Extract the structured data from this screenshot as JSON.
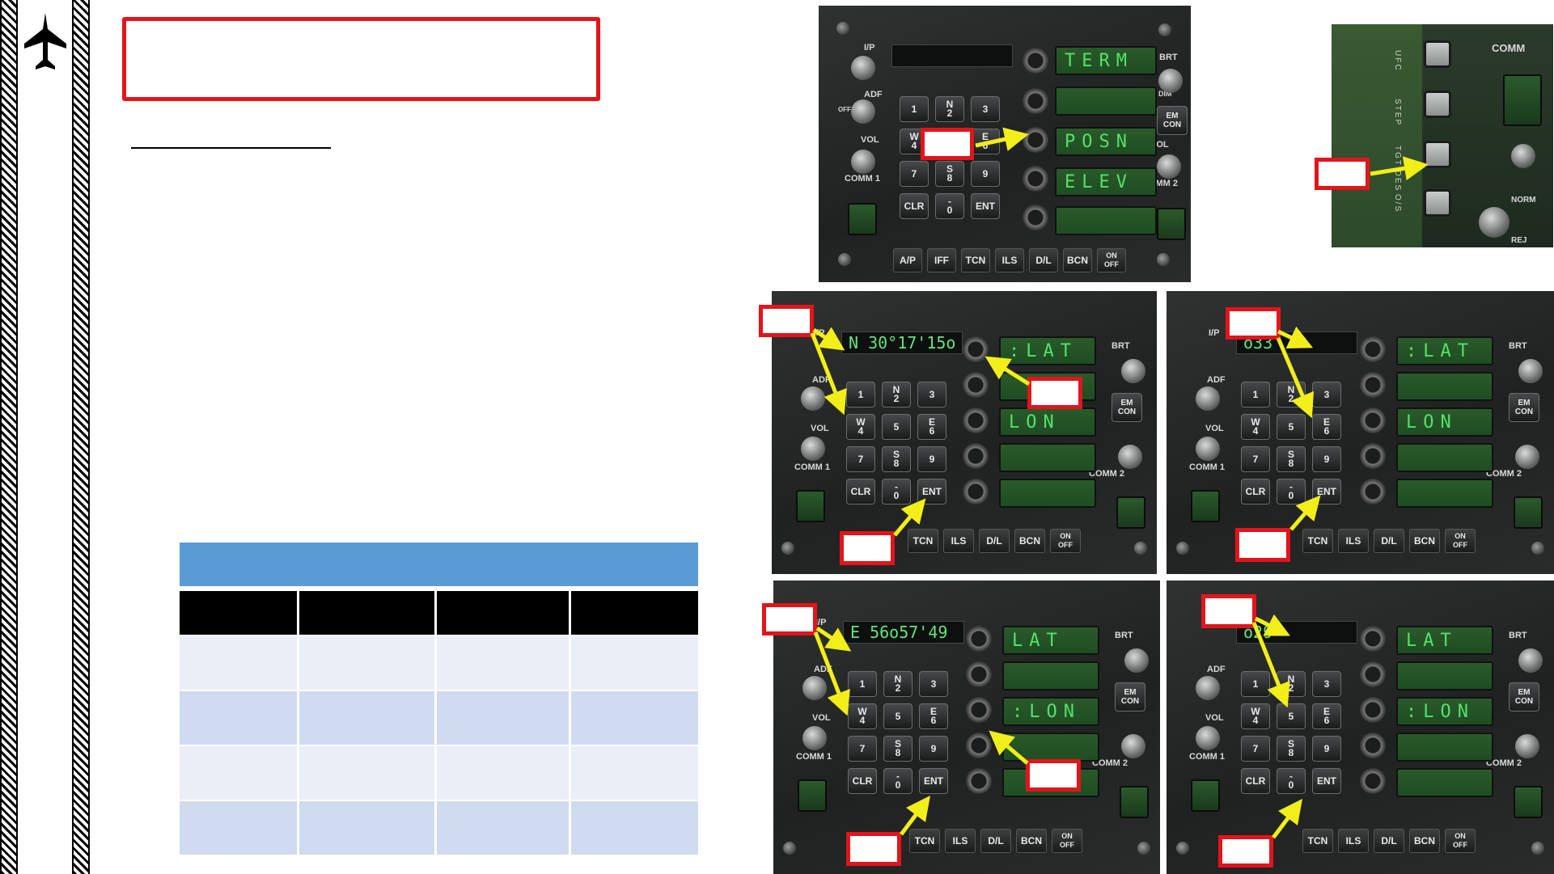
{
  "sidebar": {
    "icon": "jet-icon"
  },
  "slide": {
    "title_text": "",
    "subtitle_text": ""
  },
  "table": {
    "title": "",
    "headers": [
      "",
      "",
      "",
      ""
    ],
    "rows": [
      [
        "",
        "",
        "",
        ""
      ],
      [
        "",
        "",
        "",
        ""
      ],
      [
        "",
        "",
        "",
        ""
      ],
      [
        "",
        "",
        "",
        ""
      ]
    ]
  },
  "ufc_top": {
    "labels": {
      "ip": "I/P",
      "brt": "BRT",
      "adf": "ADF",
      "off": "OFF",
      "vol": "VOL",
      "comm1": "COMM 1",
      "comm2": "COMM 2",
      "dim": "DIM"
    },
    "displays": [
      "TERM",
      "",
      "POSN",
      "ELEV",
      ""
    ],
    "keys": [
      "1",
      "N\n2",
      "3",
      "W\n4",
      "5",
      "E\n6",
      "7",
      "S\n8",
      "9",
      "CLR",
      "-\n0",
      "ENT"
    ],
    "em_con": "EM\nCON",
    "bottom_buttons": [
      "A/P",
      "IFF",
      "TCN",
      "ILS",
      "D/L",
      "BCN",
      "ON\nOFF"
    ]
  },
  "side_panel": {
    "comm": "COMM",
    "norm": "NORM",
    "rej": "REJ",
    "labels": [
      "UFC",
      "STEP",
      "TGT DES",
      "O/S"
    ]
  },
  "ufc_steps": [
    {
      "scratchpad": "N 30°17'15o",
      "displays": [
        ":LAT",
        "",
        "LON",
        "",
        ""
      ]
    },
    {
      "scratchpad": "o33",
      "displays": [
        ":LAT",
        "",
        "LON",
        "",
        ""
      ]
    },
    {
      "scratchpad": "E 56o57'49",
      "displays": [
        "LAT",
        "",
        ":LON",
        "",
        ""
      ]
    },
    {
      "scratchpad": "o29",
      "displays": [
        "LAT",
        "",
        ":LON",
        "",
        ""
      ]
    }
  ],
  "step_keys": [
    "1",
    "N\n2",
    "3",
    "W\n4",
    "5",
    "E\n6",
    "7",
    "S\n8",
    "9",
    "CLR",
    "-\n0",
    "ENT"
  ],
  "step_bottom_buttons": [
    "TCN",
    "ILS",
    "D/L",
    "BCN",
    "ON\nOFF"
  ],
  "colors": {
    "callout_red": "#e3141c",
    "arrow_yellow": "#f2ee19",
    "table_header_blue": "#5b9bd5",
    "display_green": "#55e16a"
  }
}
